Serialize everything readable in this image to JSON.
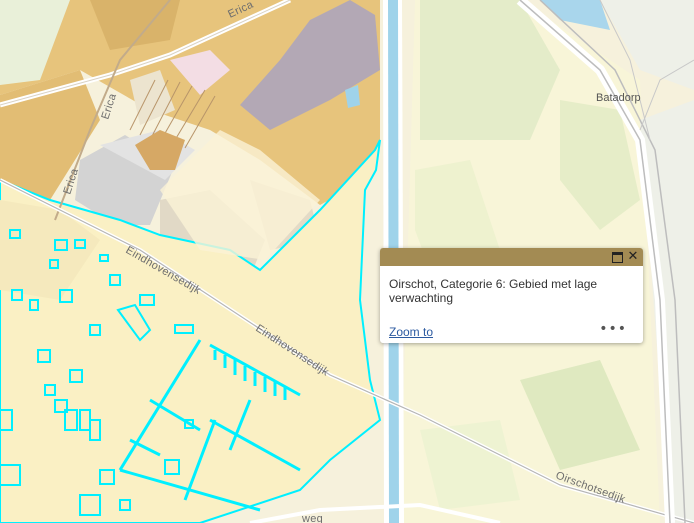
{
  "map": {
    "road_labels": [
      "Erica",
      "Erica",
      "Erica",
      "Eindhovensedijk",
      "Eindhovensedijk",
      "Oirschotsedijk",
      "weg"
    ],
    "place_labels": [
      "Batadorp"
    ]
  },
  "popup": {
    "title": "Oirschot, Categorie 6: Gebied met lage verwachting",
    "zoom_label": "Zoom to",
    "more_label": "•••",
    "close_label": "✕"
  },
  "colors": {
    "low_expectation_area": "#fbf1c7",
    "high_expectation_area": "#e8c780",
    "medium_expectation_area": "#f9e9b6",
    "outline": "#00f0ff",
    "water": "#9fd3ea",
    "green": "#dfe8c4",
    "popup_header": "#a38b53"
  }
}
